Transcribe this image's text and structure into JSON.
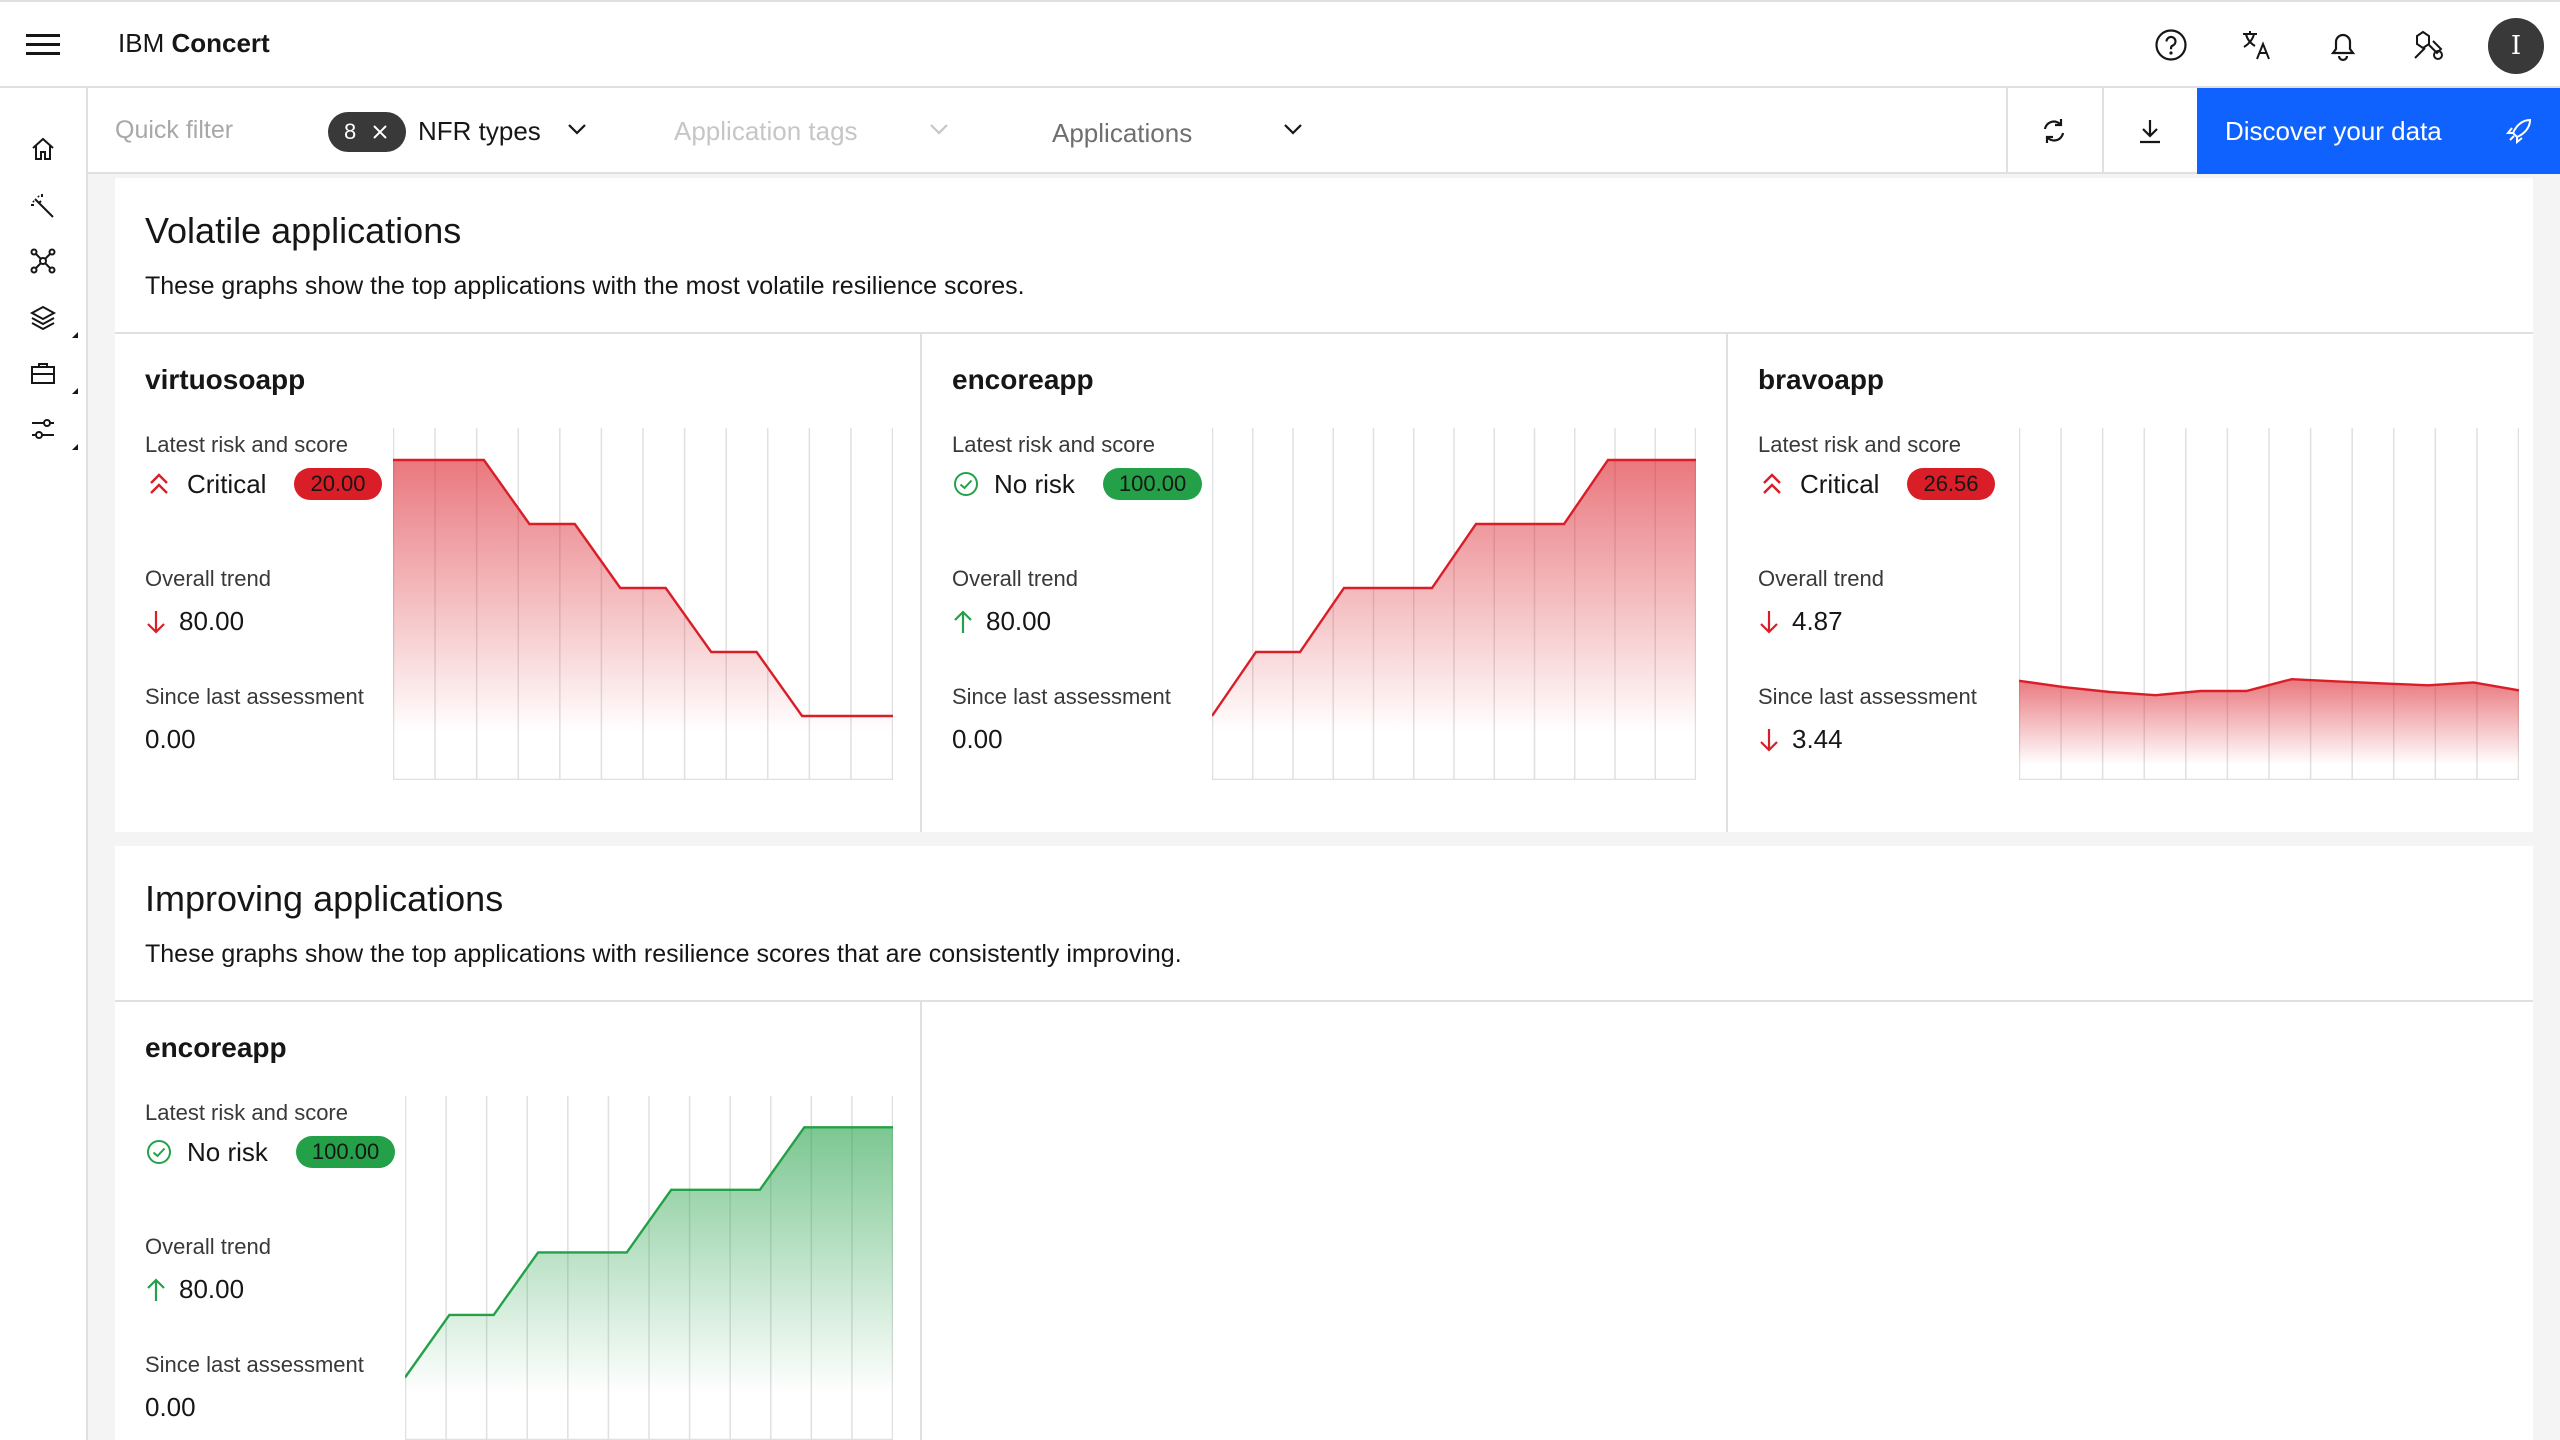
{
  "header": {
    "brand_prefix": "IBM",
    "brand_name": "Concert",
    "avatar_initial": "I"
  },
  "filters": {
    "quick_filter_placeholder": "Quick filter",
    "nfr_count": "8",
    "nfr_label": "NFR types",
    "app_tags_placeholder": "Application tags",
    "applications_label": "Applications",
    "discover_label": "Discover your data"
  },
  "volatile": {
    "title": "Volatile applications",
    "description": "These graphs show the top applications with the most volatile resilience scores.",
    "cards": [
      {
        "name": "virtuosoapp",
        "latest_label": "Latest risk and score",
        "risk_icon": "chevron-up-double-icon",
        "risk": "Critical",
        "score": "20.00",
        "trend_label": "Overall trend",
        "trend_dir": "down",
        "trend": "80.00",
        "since_label": "Since last assessment",
        "since_dir": "none",
        "since": "0.00"
      },
      {
        "name": "encoreapp",
        "latest_label": "Latest risk and score",
        "risk_icon": "checkmark-outline-icon",
        "risk": "No risk",
        "score": "100.00",
        "trend_label": "Overall trend",
        "trend_dir": "up",
        "trend": "80.00",
        "since_label": "Since last assessment",
        "since_dir": "none",
        "since": "0.00"
      },
      {
        "name": "bravoapp",
        "latest_label": "Latest risk and score",
        "risk_icon": "chevron-up-double-icon",
        "risk": "Critical",
        "score": "26.56",
        "trend_label": "Overall trend",
        "trend_dir": "down",
        "trend": "4.87",
        "since_label": "Since last assessment",
        "since_dir": "down",
        "since": "3.44"
      }
    ]
  },
  "improving": {
    "title": "Improving applications",
    "description": "These graphs show the top applications with resilience scores that are consistently improving.",
    "cards": [
      {
        "name": "encoreapp",
        "latest_label": "Latest risk and score",
        "risk_icon": "checkmark-outline-icon",
        "risk": "No risk",
        "score": "100.00",
        "trend_label": "Overall trend",
        "trend_dir": "up",
        "trend": "80.00",
        "since_label": "Since last assessment",
        "since_dir": "none",
        "since": "0.00"
      }
    ]
  },
  "colors": {
    "critical": "#da1e28",
    "ok": "#24a148",
    "primary": "#0f62fe"
  },
  "chart_data": [
    {
      "type": "area",
      "title": "",
      "series": [
        {
          "values": [
            100,
            100,
            100,
            80,
            80,
            60,
            60,
            40,
            40,
            20,
            20,
            20
          ]
        }
      ],
      "ylim": [
        0,
        110
      ],
      "grid": true
    },
    {
      "type": "area",
      "title": "",
      "series": [
        {
          "values": [
            20,
            40,
            40,
            60,
            60,
            60,
            80,
            80,
            80,
            100,
            100,
            100
          ]
        }
      ],
      "ylim": [
        0,
        110
      ],
      "grid": true
    },
    {
      "type": "area",
      "title": "",
      "series": [
        {
          "values": [
            31,
            29,
            27.5,
            26.5,
            27.8,
            27.8,
            31.5,
            30.8,
            30.2,
            29.6,
            30.5,
            28
          ]
        }
      ],
      "ylim": [
        0,
        110
      ],
      "grid": true
    },
    {
      "type": "area",
      "title": "",
      "series": [
        {
          "values": [
            20,
            40,
            40,
            60,
            60,
            60,
            80,
            80,
            80,
            100,
            100,
            100
          ]
        }
      ],
      "ylim": [
        0,
        110
      ],
      "grid": true
    }
  ]
}
